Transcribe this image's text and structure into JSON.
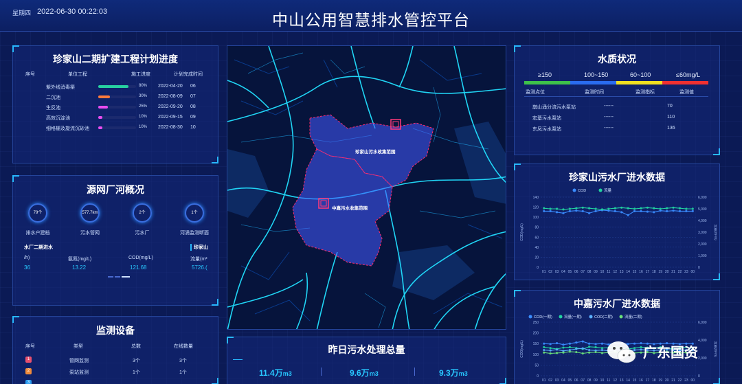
{
  "header": {
    "weekday": "星期四",
    "datetime": "2022-06-30 00:22:03",
    "title": "中山公用智慧排水管控平台"
  },
  "plan": {
    "title": "珍家山二期扩建工程计划进度",
    "columns": [
      "序号",
      "单位工程",
      "施工进度",
      "计划完成时间"
    ],
    "rows": [
      {
        "name": "紫外线消毒渠",
        "progress": 0.8,
        "percent": "80%",
        "date": "2022-04-20",
        "idx": "06",
        "color": "#27d0a0"
      },
      {
        "name": "二沉池",
        "progress": 0.3,
        "percent": "30%",
        "date": "2022-08-09",
        "idx": "07",
        "color": "#ff7a3c"
      },
      {
        "name": "生反池",
        "progress": 0.25,
        "percent": "25%",
        "date": "2022-09-20",
        "idx": "08",
        "color": "#e84cf0"
      },
      {
        "name": "高效沉淀池",
        "progress": 0.1,
        "percent": "10%",
        "date": "2022-09-15",
        "idx": "09",
        "color": "#e84cf0"
      },
      {
        "name": "细格栅及旋流沉砂池",
        "progress": 0.1,
        "percent": "10%",
        "date": "2022-08-30",
        "idx": "10",
        "color": "#e84cf0"
      }
    ]
  },
  "source": {
    "title": "源网厂河概况",
    "stats": [
      {
        "value": "79个",
        "label": "排水户建档"
      },
      {
        "value": "577.7km",
        "label": "污水管网"
      },
      {
        "value": "2个",
        "label": "污水厂"
      },
      {
        "value": "1个",
        "label": "河涌监测断面"
      }
    ],
    "left_head": "水厂二期进水",
    "right_head": "珍家山",
    "table_heads": [
      "/h)",
      "氨氮(mg/L)",
      "COD(mg/L)",
      "流量(m³"
    ],
    "table_vals": [
      "36",
      "13.22",
      "121.68",
      "5726.("
    ]
  },
  "devices": {
    "title": "监测设备",
    "columns": [
      "序号",
      "类型",
      "总数",
      "在线数量"
    ],
    "rows": [
      {
        "idx": "1",
        "type": "管网监测",
        "total": "3个",
        "online": "3个",
        "color": "#e8506e"
      },
      {
        "idx": "2",
        "type": "泵站监测",
        "total": "1个",
        "online": "1个",
        "color": "#f08a3a"
      },
      {
        "idx": "3",
        "type": "",
        "total": "",
        "online": "",
        "color": "#2a9cf0"
      }
    ]
  },
  "map": {
    "area1": "珍家山污水收集范围",
    "area2": "中嘉污水收集范围"
  },
  "summary": {
    "title": "昨日污水处理总量",
    "values": [
      "11.4万",
      "9.6万",
      "9.3万"
    ],
    "unit": "m3"
  },
  "water": {
    "title": "水质状况",
    "legend": [
      {
        "label": "≥150",
        "color": "#3ec24a"
      },
      {
        "label": "100~150",
        "color": "#2a6cf0"
      },
      {
        "label": "60~100",
        "color": "#f0e020"
      },
      {
        "label": "≤60mg/L",
        "color": "#f03030"
      }
    ],
    "columns": [
      "监测点位",
      "监测时间",
      "监测指标",
      "监测值"
    ],
    "rows": [
      {
        "site": "崩山涌分流污水泵站",
        "time": "------",
        "value": "70"
      },
      {
        "site": "宏基污水泵站",
        "time": "------",
        "value": "110"
      },
      {
        "site": "东凤污水泵站",
        "time": "------",
        "value": "136"
      }
    ]
  },
  "chart1": {
    "title": "珍家山污水厂进水数据"
  },
  "chart2": {
    "title": "中嘉污水厂进水数据"
  },
  "chart_data": [
    {
      "type": "line",
      "title": "珍家山污水厂进水数据",
      "ylabel": "COD(mg/L)",
      "ylabel_right": "流量(m³/h)",
      "categories": [
        "01",
        "02",
        "03",
        "04",
        "05",
        "06",
        "07",
        "08",
        "09",
        "10",
        "11",
        "12",
        "13",
        "14",
        "15",
        "16",
        "17",
        "18",
        "19",
        "20",
        "21",
        "22",
        "23",
        "00"
      ],
      "ylim": [
        0,
        140
      ],
      "yticks": [
        0,
        20,
        40,
        60,
        80,
        100,
        120,
        140
      ],
      "ylim_right": [
        0,
        6000
      ],
      "yticks_right": [
        "0",
        "1,000",
        "2,000",
        "3,000",
        "4,000",
        "5,000",
        "6,000"
      ],
      "series": [
        {
          "name": "COD",
          "color": "#3a8cff",
          "axis": "left",
          "values": [
            112,
            112,
            110,
            108,
            112,
            113,
            112,
            108,
            112,
            114,
            113,
            112,
            110,
            104,
            112,
            112,
            111,
            110,
            113,
            112,
            113,
            112,
            112,
            112
          ]
        },
        {
          "name": "流量",
          "color": "#22d3a0",
          "axis": "right",
          "values": [
            5050,
            5000,
            5000,
            4950,
            5000,
            5050,
            5100,
            5050,
            5000,
            4950,
            5000,
            5050,
            5100,
            5050,
            5000,
            5050,
            5100,
            5050,
            5000,
            5050,
            5100,
            5050,
            5000,
            5000
          ]
        }
      ]
    },
    {
      "type": "line",
      "title": "中嘉污水厂进水数据",
      "ylabel": "COD(mg/L)",
      "ylabel_right": "流量(m³/h)",
      "categories": [
        "01",
        "02",
        "03",
        "04",
        "05",
        "06",
        "07",
        "08",
        "09",
        "10",
        "11",
        "12",
        "13",
        "14",
        "15",
        "16",
        "17",
        "18",
        "19",
        "20",
        "21",
        "22",
        "23",
        "00"
      ],
      "ylim": [
        0,
        250
      ],
      "yticks": [
        0,
        50,
        100,
        150,
        200,
        250
      ],
      "ylim_right": [
        0,
        6000
      ],
      "yticks_right": [
        "0",
        "2,000",
        "4,000",
        "6,000"
      ],
      "series": [
        {
          "name": "COD(一期)",
          "color": "#3a8cff",
          "axis": "left",
          "values": [
            150,
            148,
            152,
            145,
            150,
            155,
            160,
            150,
            148,
            150,
            146,
            152,
            150,
            148,
            150,
            152,
            150,
            148,
            150,
            152,
            150,
            148,
            150,
            150
          ]
        },
        {
          "name": "流量(一期)",
          "color": "#22d3a0",
          "axis": "right",
          "values": [
            3200,
            3100,
            3000,
            3150,
            3200,
            3100,
            3000,
            3250,
            3200,
            3100,
            3150,
            3200,
            3100,
            3000,
            3100,
            3200,
            3150,
            3100,
            3200,
            3100,
            3000,
            3100,
            3200,
            3100
          ]
        },
        {
          "name": "COD(二期)",
          "color": "#5ab0ff",
          "axis": "left",
          "values": [
            120,
            118,
            122,
            116,
            120,
            125,
            128,
            120,
            118,
            120,
            116,
            122,
            120,
            118,
            120,
            122,
            120,
            118,
            120,
            122,
            120,
            118,
            120,
            120
          ]
        },
        {
          "name": "流量(二期)",
          "color": "#6ae07a",
          "axis": "right",
          "values": [
            2600,
            2500,
            2550,
            2600,
            2700,
            2650,
            2500,
            2600,
            2650,
            2550,
            2600,
            2700,
            2600,
            2500,
            2550,
            2600,
            2650,
            2550,
            2600,
            2700,
            2600,
            2550,
            2600,
            2600
          ]
        }
      ]
    }
  ],
  "watermark": {
    "text": "广东国资"
  }
}
